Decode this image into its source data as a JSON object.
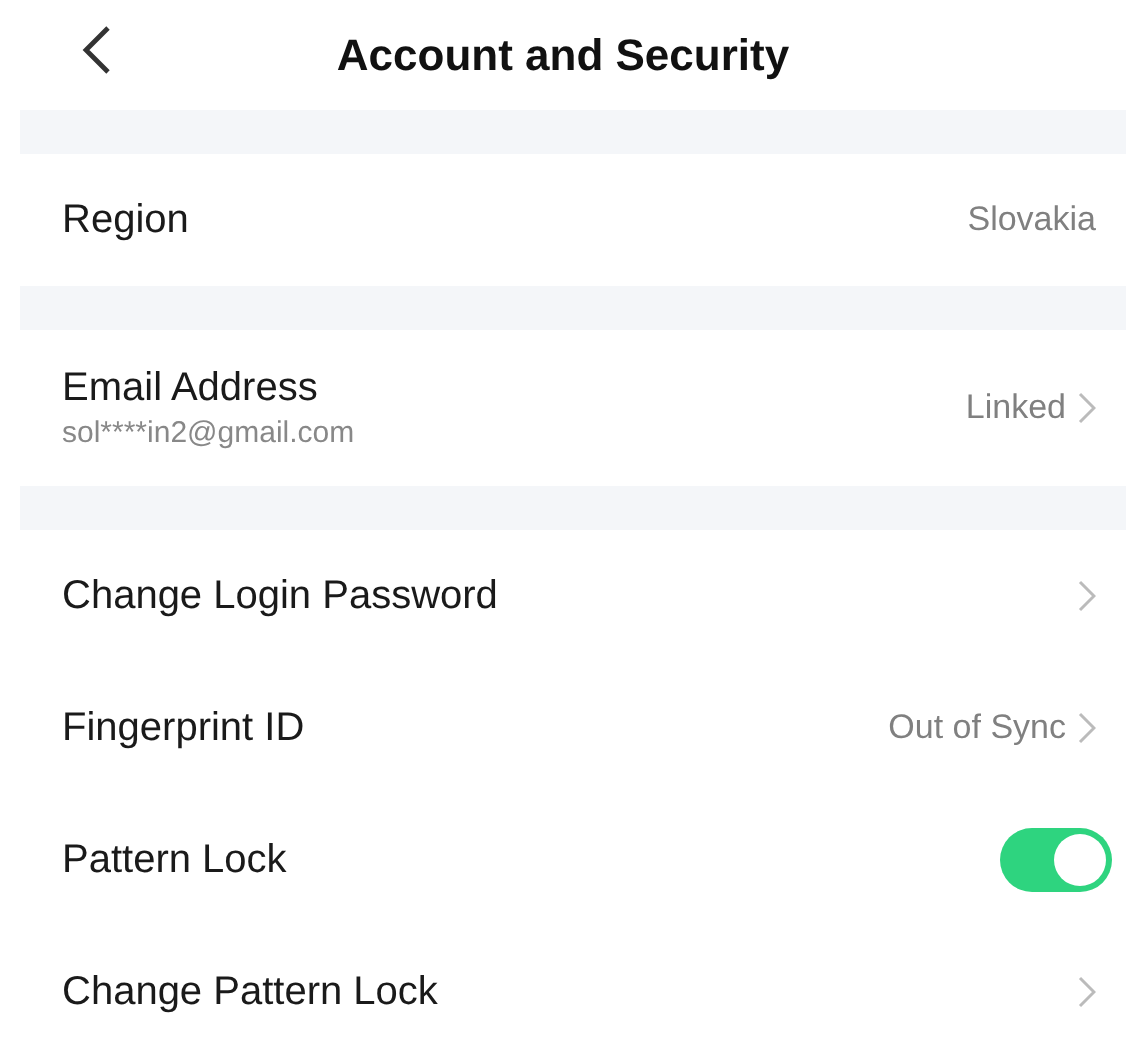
{
  "header": {
    "title": "Account and Security"
  },
  "sections": [
    {
      "items": [
        {
          "kind": "value",
          "label": "Region",
          "value": "Slovakia",
          "chevron": false
        }
      ]
    },
    {
      "items": [
        {
          "kind": "value",
          "label": "Email Address",
          "sublabel": "sol****in2@gmail.com",
          "value": "Linked",
          "chevron": true
        }
      ]
    },
    {
      "items": [
        {
          "kind": "value",
          "label": "Change Login Password",
          "chevron": true
        },
        {
          "kind": "value",
          "label": "Fingerprint ID",
          "value": "Out of Sync",
          "chevron": true
        },
        {
          "kind": "toggle",
          "label": "Pattern Lock",
          "on": true
        },
        {
          "kind": "value",
          "label": "Change Pattern Lock",
          "chevron": true
        }
      ]
    }
  ]
}
